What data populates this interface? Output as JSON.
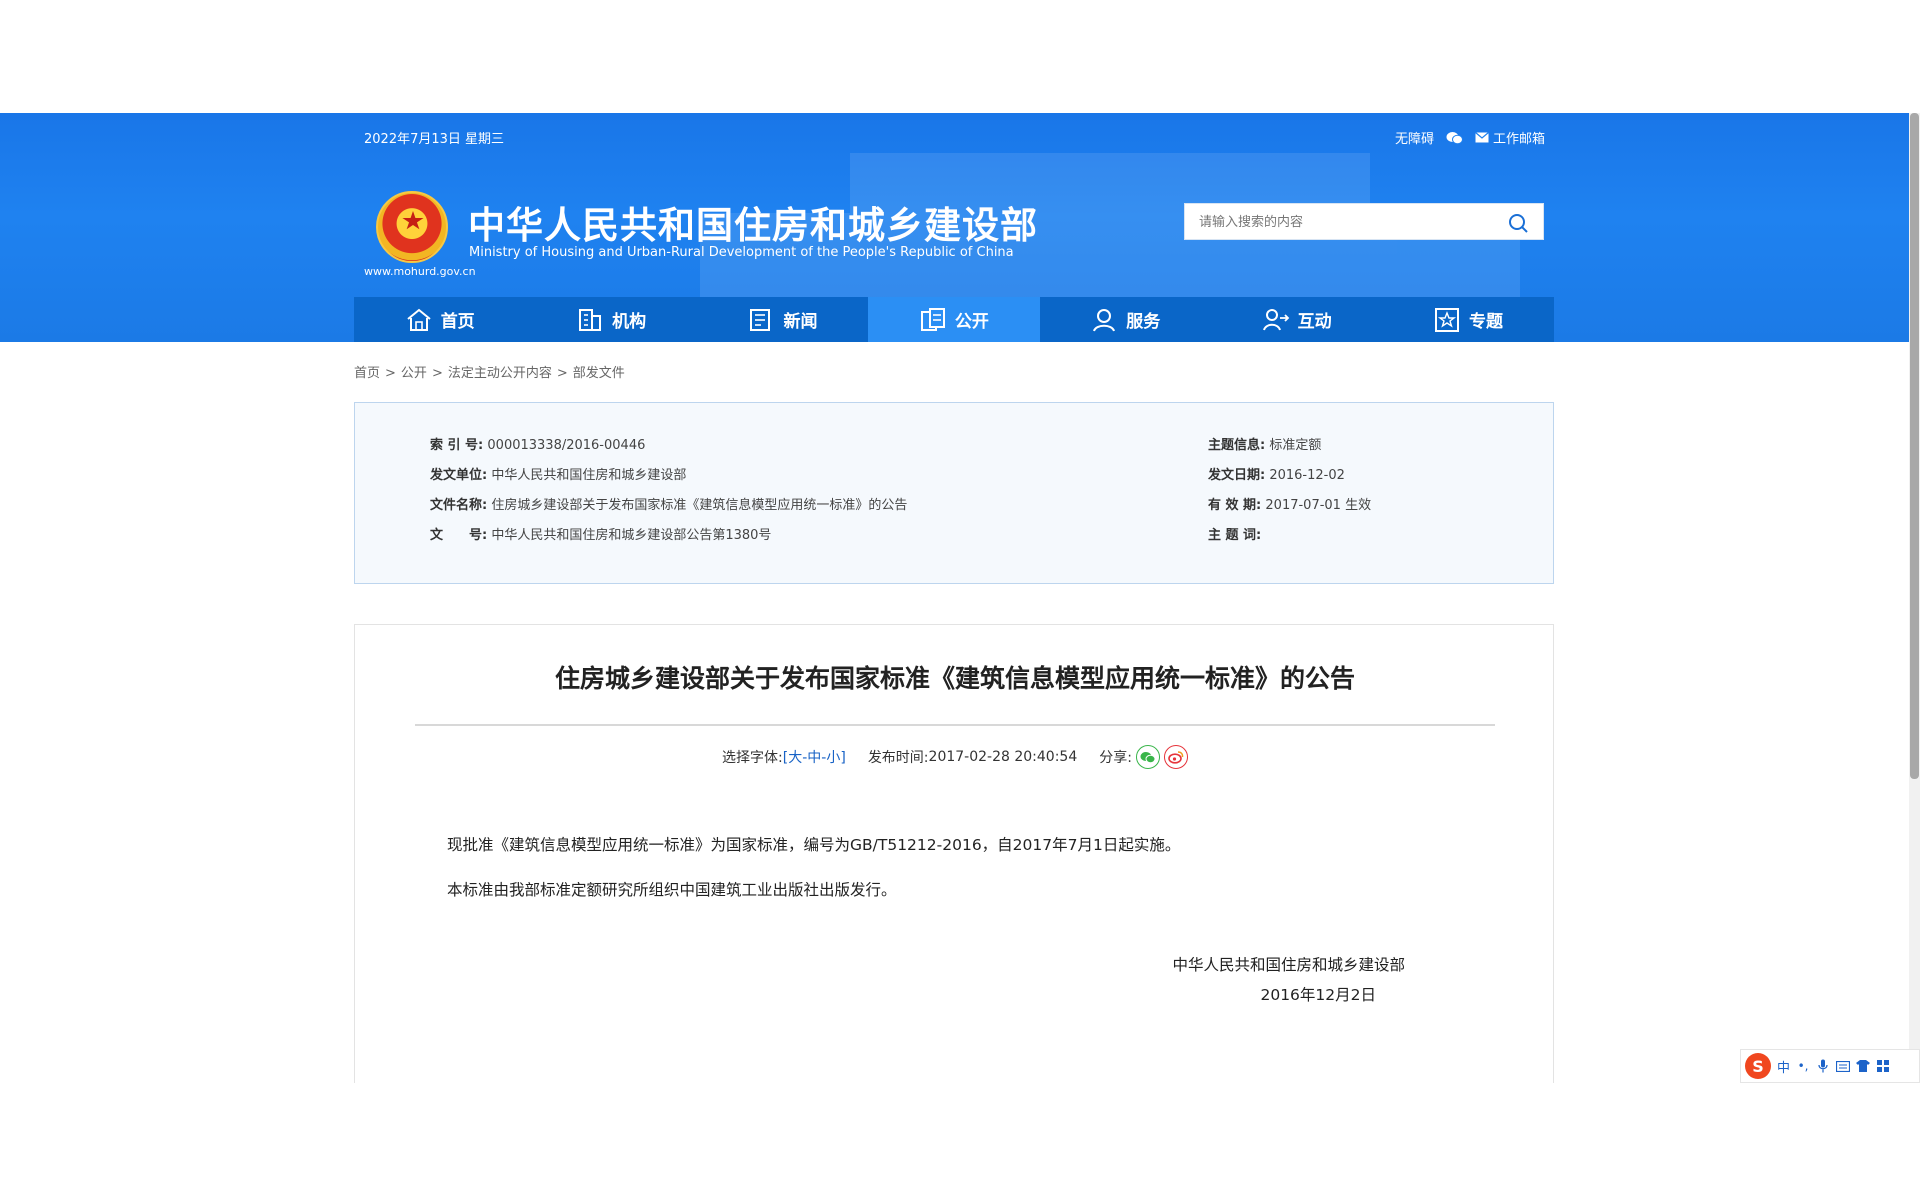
{
  "header": {
    "date": "2022年7月13日 星期三",
    "accessibility": "无障碍",
    "work_email": "工作邮箱",
    "site_title": "中华人民共和国住房和城乡建设部",
    "site_subtitle": "Ministry of Housing and Urban-Rural Development of the People's Republic of China",
    "site_url": "www.mohurd.gov.cn",
    "search_placeholder": "请输入搜索的内容"
  },
  "nav": {
    "items": [
      {
        "label": "首页",
        "icon": "home-icon"
      },
      {
        "label": "机构",
        "icon": "building-icon"
      },
      {
        "label": "新闻",
        "icon": "newspaper-icon"
      },
      {
        "label": "公开",
        "icon": "document-icon"
      },
      {
        "label": "服务",
        "icon": "service-icon"
      },
      {
        "label": "互动",
        "icon": "interaction-icon"
      },
      {
        "label": "专题",
        "icon": "star-icon"
      }
    ],
    "active": "公开"
  },
  "breadcrumb": {
    "items": [
      "首页",
      "公开",
      "法定主动公开内容",
      "部发文件"
    ],
    "separator": ">"
  },
  "info": {
    "index_label": "索 引 号:",
    "index_value": "000013338/2016-00446",
    "issuer_label": "发文单位:",
    "issuer_value": "中华人民共和国住房和城乡建设部",
    "docname_label": "文件名称:",
    "docname_value": "住房城乡建设部关于发布国家标准《建筑信息模型应用统一标准》的公告",
    "docno_label": "文　　号:",
    "docno_value": "中华人民共和国住房和城乡建设部公告第1380号",
    "topic_label": "主题信息:",
    "topic_value": "标准定额",
    "date_label": "发文日期:",
    "date_value": "2016-12-02",
    "validity_label": "有 效 期:",
    "validity_value": "2017-07-01 生效",
    "keywords_label": "主 题 词:",
    "keywords_value": ""
  },
  "article": {
    "title": "住房城乡建设部关于发布国家标准《建筑信息模型应用统一标准》的公告",
    "font_select_label": "选择字体:",
    "font_large": "大",
    "font_medium": "中",
    "font_small": "小",
    "publish_label": "发布时间:",
    "publish_time": "2017-02-28 20:40:54",
    "share_label": "分享:",
    "paragraphs": [
      "现批准《建筑信息模型应用统一标准》为国家标准，编号为GB/T51212-2016，自2017年7月1日起实施。",
      "本标准由我部标准定额研究所组织中国建筑工业出版社出版发行。"
    ],
    "signer": "中华人民共和国住房和城乡建设部",
    "sign_date": "2016年12月2日"
  },
  "ime": {
    "logo": "S",
    "lang": "中"
  },
  "colors": {
    "header_blue": "#1f82f0",
    "nav_blue": "#0a66c8",
    "nav_active": "#2b8ff4",
    "link_blue": "#1762c6"
  }
}
